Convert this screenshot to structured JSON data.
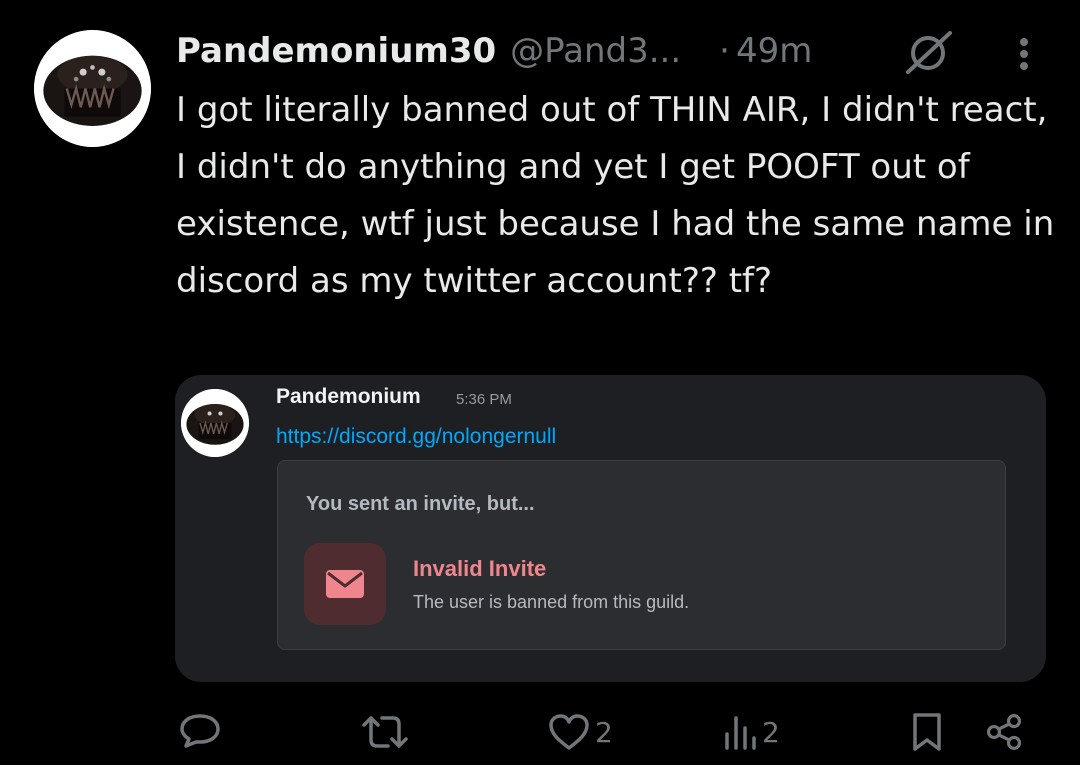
{
  "tweet": {
    "display_name": "Pandemonium30",
    "handle": "@Pand3...",
    "separator": "·",
    "time": "49m",
    "text": "I got literally banned out of THIN AIR, I didn't react, I didn't do anything and yet I get POOFT out of existence, wtf just because I had the same name in discord as my twitter account?? tf?"
  },
  "embed": {
    "username": "Pandemonium",
    "timestamp": "5:36 PM",
    "link": "https://discord.gg/nolongernull",
    "invite": {
      "heading": "You sent an invite, but...",
      "title": "Invalid Invite",
      "subtitle": "The user is banned from this guild."
    }
  },
  "actions": {
    "reply_count": "",
    "retweet_count": "",
    "like_count": "2",
    "views_count": "2"
  },
  "icons": {
    "header": [
      "grok-icon",
      "more-icon"
    ],
    "actions": [
      "reply-icon",
      "retweet-icon",
      "like-icon",
      "views-icon",
      "bookmark-icon",
      "share-icon"
    ],
    "invite": "envelope-icon"
  },
  "colors": {
    "background": "#000000",
    "text": "#e7e9ea",
    "muted": "#71767b",
    "embed_bg": "#1e1f22",
    "link": "#00a8fc",
    "invalid": "#f0868d"
  }
}
